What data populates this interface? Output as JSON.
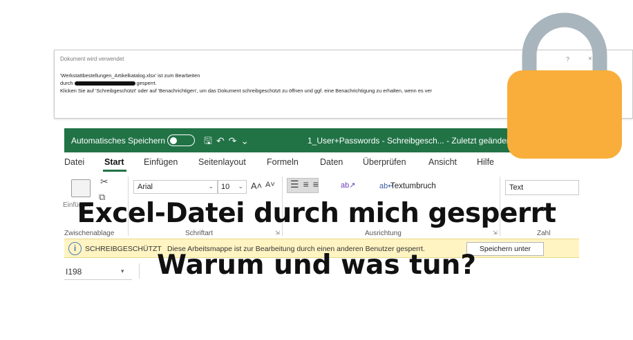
{
  "dialog": {
    "title": "Dokument wird verwendet",
    "help": "?",
    "close": "×",
    "line1": "'Werkstattbestellungen_Artikelkatalog.xlsx' ist zum Bearbeiten",
    "line2_prefix": "durch",
    "line2_suffix": "gesperrt.",
    "line3": "Klicken Sie auf 'Schreibgeschützt' oder auf 'Benachrichtigen', um das Dokument schreibgeschützt zu öffnen und ggf. eine Benachrichtigung zu erhalten, wenn es ver"
  },
  "excel": {
    "titlebar": {
      "autosave_label": "Automatisches Speichern",
      "document_title": "1_User+Passwords - Schreibgesch... - Zuletzt geändert"
    },
    "menu": [
      "Datei",
      "Start",
      "Einfügen",
      "Seitenlayout",
      "Formeln",
      "Daten",
      "Überprüfen",
      "Ansicht",
      "Hilfe"
    ],
    "ribbon": {
      "paste_label": "Einfügen",
      "font_name": "Arial",
      "font_size": "10",
      "grow_font": "A˄",
      "shrink_font": "A˅",
      "wrap_text": "Textumbruch",
      "number_format": "Text",
      "groups": {
        "clipboard": "Zwischenablage",
        "font": "Schriftart",
        "alignment": "Ausrichtung",
        "number": "Zahl"
      }
    },
    "infobar": {
      "title": "SCHREIBGESCHÜTZT",
      "message": "Diese Arbeitsmappe ist zur Bearbeitung durch einen anderen Benutzer gesperrt.",
      "button": "Speichern unter"
    },
    "namebox": "I198"
  },
  "headline": {
    "line1": "Excel-Datei durch mich gesperrt",
    "line2": "Warum und was tun?"
  },
  "colors": {
    "excel_green": "#217346",
    "infobar_bg": "#fff4c2",
    "lock_body": "#f9ae3b",
    "lock_shackle": "#a9b5bd"
  },
  "icons": {
    "lock": "padlock-icon",
    "info": "info-icon"
  }
}
